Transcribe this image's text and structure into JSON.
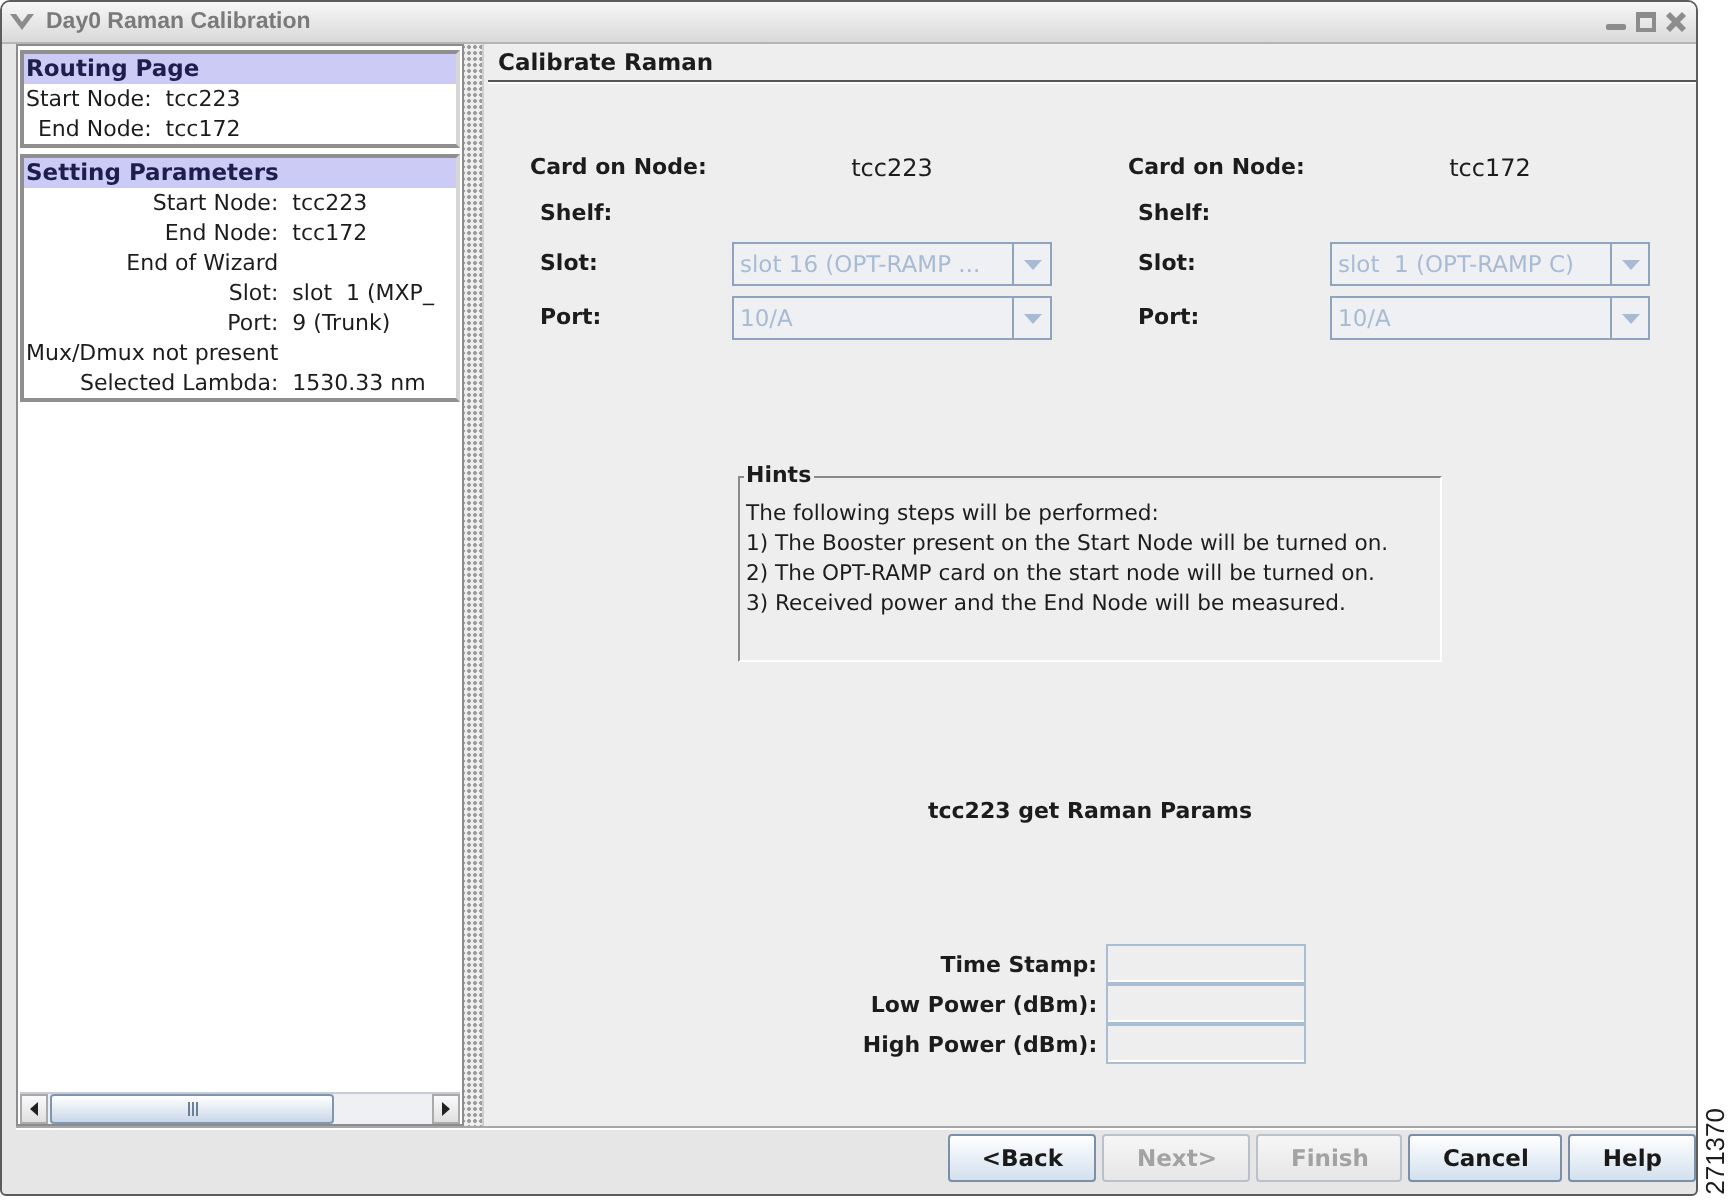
{
  "window": {
    "title": "Day0 Raman Calibration"
  },
  "sidebar": {
    "sections": [
      {
        "title": "Routing Page",
        "lines": [
          {
            "label": "Start Node:",
            "value": "tcc223"
          },
          {
            "label": "End Node:",
            "value": "tcc172"
          }
        ]
      },
      {
        "title": "Setting Parameters",
        "lines": [
          {
            "label": "Start Node:",
            "value": "tcc223"
          },
          {
            "label": "End Node:",
            "value": "tcc172"
          },
          {
            "label": "End of Wizard"
          },
          {
            "label": "Slot:",
            "value": "slot  1 (MXP_"
          },
          {
            "label": "Port:",
            "value": "9 (Trunk)"
          },
          {
            "label": "Mux/Dmux not present"
          },
          {
            "label": "Selected Lambda:",
            "value": "1530.33 nm"
          }
        ]
      }
    ]
  },
  "page": {
    "title": "Calibrate Raman",
    "cards": [
      {
        "label": "Card on Node:",
        "node": "tcc223",
        "fields": [
          {
            "kind": "label",
            "label": "Shelf:"
          },
          {
            "kind": "combo",
            "label": "Slot:",
            "value": "slot 16 (OPT-RAMP ...",
            "disabled": true
          },
          {
            "kind": "combo",
            "label": "Port:",
            "value": "10/A",
            "disabled": true
          }
        ]
      },
      {
        "label": "Card on Node:",
        "node": "tcc172",
        "fields": [
          {
            "kind": "label",
            "label": "Shelf:"
          },
          {
            "kind": "combo",
            "label": "Slot:",
            "value": "slot  1 (OPT-RAMP C)",
            "disabled": true
          },
          {
            "kind": "combo",
            "label": "Port:",
            "value": "10/A",
            "disabled": true
          }
        ]
      }
    ],
    "hints": {
      "title": "Hints",
      "lines": [
        "The following steps will be performed:",
        "1) The Booster present on the Start Node will be turned on.",
        "2) The OPT-RAMP card on the start node will be turned on.",
        "3) Received power and the End Node will be measured."
      ]
    },
    "status": "tcc223 get Raman Params",
    "results": [
      {
        "label": "Time Stamp:"
      },
      {
        "label": "Low Power (dBm):"
      },
      {
        "label": "High Power (dBm):"
      }
    ]
  },
  "buttons": [
    {
      "label": "<Back",
      "disabled": false
    },
    {
      "label": "Next>",
      "disabled": true
    },
    {
      "label": "Finish",
      "disabled": true
    },
    {
      "label": "Cancel",
      "disabled": false
    },
    {
      "label": "Help",
      "disabled": false
    }
  ],
  "figure_number": "271370"
}
